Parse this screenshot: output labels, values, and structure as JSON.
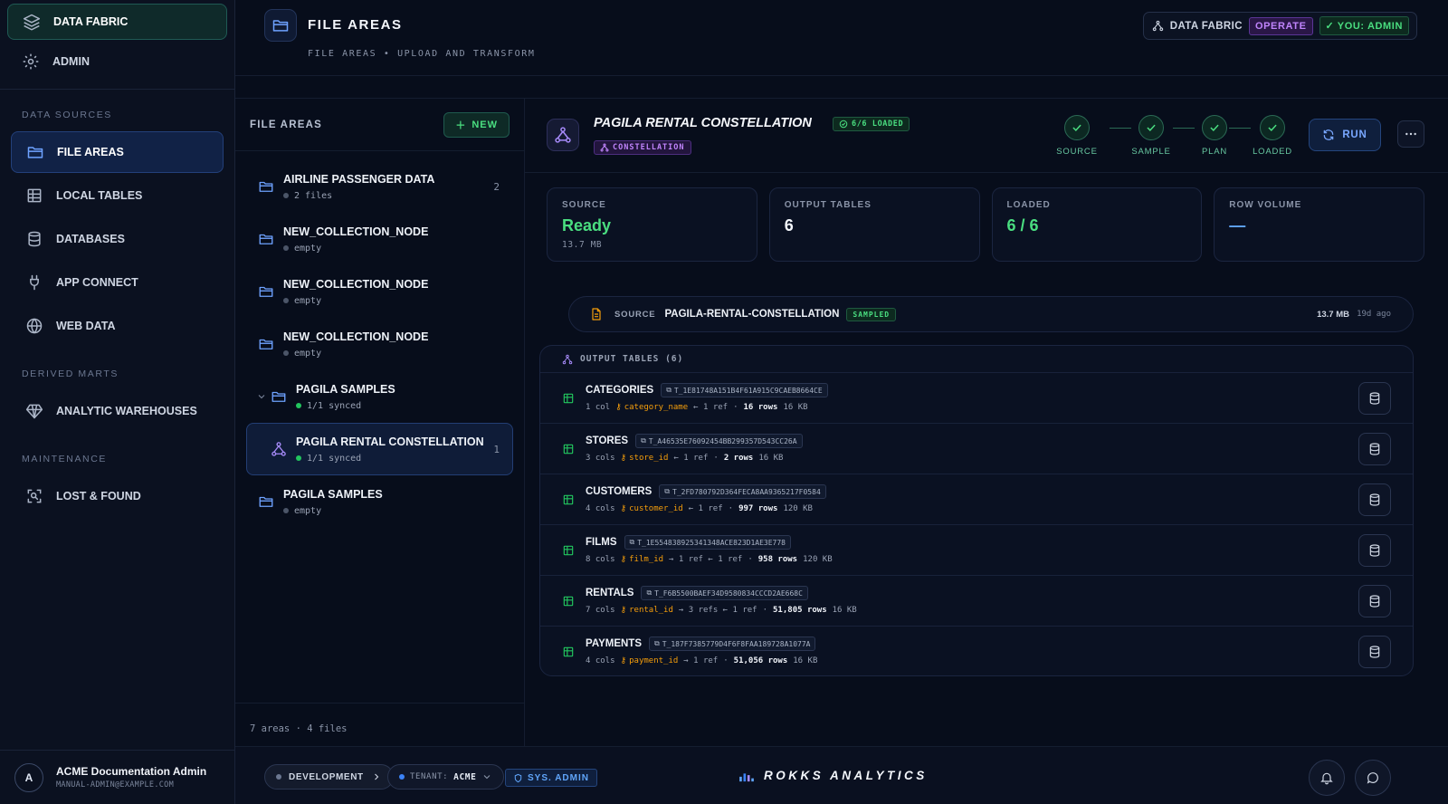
{
  "app": {
    "top_item": "DATA FABRIC",
    "admin_item": "ADMIN"
  },
  "sidebar": {
    "sections": [
      "DATA SOURCES",
      "DERIVED MARTS",
      "MAINTENANCE"
    ],
    "data_sources": [
      {
        "label": "FILE AREAS",
        "icon": "folder-icon",
        "active": true
      },
      {
        "label": "LOCAL TABLES",
        "icon": "table-icon"
      },
      {
        "label": "DATABASES",
        "icon": "database-icon"
      },
      {
        "label": "APP CONNECT",
        "icon": "plug-icon"
      },
      {
        "label": "WEB DATA",
        "icon": "globe-icon"
      }
    ],
    "derived_marts": [
      {
        "label": "ANALYTIC WAREHOUSES",
        "icon": "diamond-icon"
      }
    ],
    "maintenance": [
      {
        "label": "LOST & FOUND",
        "icon": "scan-icon"
      }
    ],
    "user": {
      "initial": "A",
      "name": "ACME Documentation Admin",
      "email": "MANUAL-ADMIN@EXAMPLE.COM"
    }
  },
  "header": {
    "title": "FILE AREAS",
    "subtitle": "FILE AREAS • UPLOAD AND TRANSFORM",
    "workspace": "DATA FABRIC",
    "mode_badge": "OPERATE",
    "role_badge": "YOU: ADMIN"
  },
  "areas": {
    "title": "FILE AREAS",
    "new_button": "NEW",
    "items": [
      {
        "name": "AIRLINE PASSENGER DATA",
        "meta": "2 files",
        "count": "2",
        "status": "gray"
      },
      {
        "name": "NEW_COLLECTION_NODE",
        "meta": "empty",
        "count": "",
        "status": "gray"
      },
      {
        "name": "NEW_COLLECTION_NODE",
        "meta": "empty",
        "count": "",
        "status": "gray"
      },
      {
        "name": "NEW_COLLECTION_NODE",
        "meta": "empty",
        "count": "",
        "status": "gray"
      },
      {
        "name": "PAGILA SAMPLES",
        "meta": "1/1 synced",
        "count": "",
        "status": "green"
      },
      {
        "name": "PAGILA RENTAL CONSTELLATION",
        "meta": "1/1 synced",
        "count": "1",
        "status": "green"
      },
      {
        "name": "PAGILA SAMPLES",
        "meta": "empty",
        "count": "",
        "status": "gray"
      }
    ],
    "footer": "7 areas · 4 files"
  },
  "detail": {
    "title": "PAGILA RENTAL CONSTELLATION",
    "loaded_badge": "6/6 LOADED",
    "type_badge": "CONSTELLATION",
    "steps": [
      "SOURCE",
      "SAMPLE",
      "PLAN",
      "LOADED"
    ],
    "run_button": "RUN",
    "stats": [
      {
        "label": "SOURCE",
        "value": "Ready",
        "sub": "13.7 MB"
      },
      {
        "label": "OUTPUT TABLES",
        "value": "6",
        "sub": ""
      },
      {
        "label": "LOADED",
        "value": "6 / 6",
        "sub": ""
      },
      {
        "label": "ROW VOLUME",
        "value": "—",
        "sub": ""
      }
    ],
    "source": {
      "label": "SOURCE",
      "name": "PAGILA-RENTAL-CONSTELLATION",
      "badge": "SAMPLED",
      "size": "13.7 MB",
      "ago": "19d ago"
    },
    "output_title": "OUTPUT TABLES (6)",
    "tables": [
      {
        "name": "CATEGORIES",
        "id": "T_1E81748A151B4F61A915C9CAEB8664CE",
        "cols": "1 col",
        "key": "category_name",
        "refs": "← 1 ref",
        "rows": "16 rows",
        "size": "16 KB"
      },
      {
        "name": "STORES",
        "id": "T_A46535E76092454BB299357D543CC26A",
        "cols": "3 cols",
        "key": "store_id",
        "refs": "← 1 ref",
        "rows": "2 rows",
        "size": "16 KB"
      },
      {
        "name": "CUSTOMERS",
        "id": "T_2FD780792D364FECA8AA9365217F0584",
        "cols": "4 cols",
        "key": "customer_id",
        "refs": "← 1 ref",
        "rows": "997 rows",
        "size": "120 KB"
      },
      {
        "name": "FILMS",
        "id": "T_1E554838925341348ACE823D1AE3E778",
        "cols": "8 cols",
        "key": "film_id",
        "refs": "→ 1 ref ← 1 ref",
        "rows": "958 rows",
        "size": "120 KB"
      },
      {
        "name": "RENTALS",
        "id": "T_F6B5500BAEF34D9580834CCCD2AE668C",
        "cols": "7 cols",
        "key": "rental_id",
        "refs": "→ 3 refs ← 1 ref",
        "rows": "51,805 rows",
        "size": "16 KB"
      },
      {
        "name": "PAYMENTS",
        "id": "T_187F7385779D4F6F8FAA189728A1077A",
        "cols": "4 cols",
        "key": "payment_id",
        "refs": "→ 1 ref",
        "rows": "51,056 rows",
        "size": "16 KB"
      }
    ]
  },
  "bottom": {
    "env": "DEVELOPMENT",
    "tenant_label": "TENANT:",
    "tenant_value": "ACME",
    "sys_badge": "SYS. ADMIN",
    "brand": "ROKKS ANALYTICS"
  }
}
